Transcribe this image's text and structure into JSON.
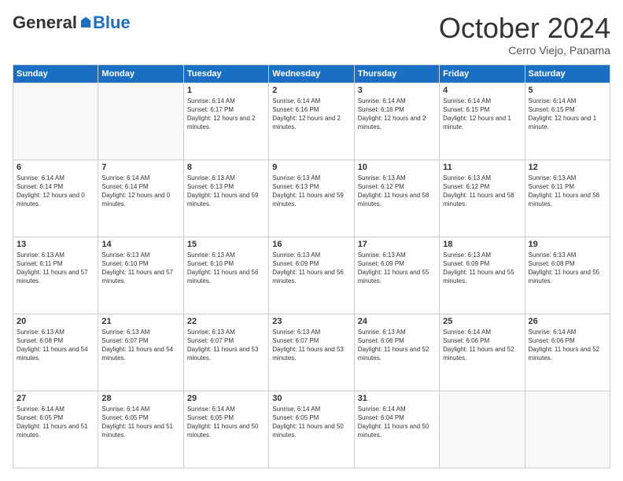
{
  "header": {
    "logo_general": "General",
    "logo_blue": "Blue",
    "month_title": "October 2024",
    "subtitle": "Cerro Viejo, Panama"
  },
  "days_of_week": [
    "Sunday",
    "Monday",
    "Tuesday",
    "Wednesday",
    "Thursday",
    "Friday",
    "Saturday"
  ],
  "weeks": [
    [
      {
        "day": "",
        "info": ""
      },
      {
        "day": "",
        "info": ""
      },
      {
        "day": "1",
        "info": "Sunrise: 6:14 AM\nSunset: 6:17 PM\nDaylight: 12 hours and 2 minutes."
      },
      {
        "day": "2",
        "info": "Sunrise: 6:14 AM\nSunset: 6:16 PM\nDaylight: 12 hours and 2 minutes."
      },
      {
        "day": "3",
        "info": "Sunrise: 6:14 AM\nSunset: 6:16 PM\nDaylight: 12 hours and 2 minutes."
      },
      {
        "day": "4",
        "info": "Sunrise: 6:14 AM\nSunset: 6:15 PM\nDaylight: 12 hours and 1 minute."
      },
      {
        "day": "5",
        "info": "Sunrise: 6:14 AM\nSunset: 6:15 PM\nDaylight: 12 hours and 1 minute."
      }
    ],
    [
      {
        "day": "6",
        "info": "Sunrise: 6:14 AM\nSunset: 6:14 PM\nDaylight: 12 hours and 0 minutes."
      },
      {
        "day": "7",
        "info": "Sunrise: 6:14 AM\nSunset: 6:14 PM\nDaylight: 12 hours and 0 minutes."
      },
      {
        "day": "8",
        "info": "Sunrise: 6:13 AM\nSunset: 6:13 PM\nDaylight: 11 hours and 59 minutes."
      },
      {
        "day": "9",
        "info": "Sunrise: 6:13 AM\nSunset: 6:13 PM\nDaylight: 11 hours and 59 minutes."
      },
      {
        "day": "10",
        "info": "Sunrise: 6:13 AM\nSunset: 6:12 PM\nDaylight: 11 hours and 58 minutes."
      },
      {
        "day": "11",
        "info": "Sunrise: 6:13 AM\nSunset: 6:12 PM\nDaylight: 11 hours and 58 minutes."
      },
      {
        "day": "12",
        "info": "Sunrise: 6:13 AM\nSunset: 6:11 PM\nDaylight: 11 hours and 58 minutes."
      }
    ],
    [
      {
        "day": "13",
        "info": "Sunrise: 6:13 AM\nSunset: 6:11 PM\nDaylight: 11 hours and 57 minutes."
      },
      {
        "day": "14",
        "info": "Sunrise: 6:13 AM\nSunset: 6:10 PM\nDaylight: 11 hours and 57 minutes."
      },
      {
        "day": "15",
        "info": "Sunrise: 6:13 AM\nSunset: 6:10 PM\nDaylight: 11 hours and 56 minutes."
      },
      {
        "day": "16",
        "info": "Sunrise: 6:13 AM\nSunset: 6:09 PM\nDaylight: 11 hours and 56 minutes."
      },
      {
        "day": "17",
        "info": "Sunrise: 6:13 AM\nSunset: 6:09 PM\nDaylight: 11 hours and 55 minutes."
      },
      {
        "day": "18",
        "info": "Sunrise: 6:13 AM\nSunset: 6:09 PM\nDaylight: 11 hours and 55 minutes."
      },
      {
        "day": "19",
        "info": "Sunrise: 6:13 AM\nSunset: 6:08 PM\nDaylight: 11 hours and 55 minutes."
      }
    ],
    [
      {
        "day": "20",
        "info": "Sunrise: 6:13 AM\nSunset: 6:08 PM\nDaylight: 11 hours and 54 minutes."
      },
      {
        "day": "21",
        "info": "Sunrise: 6:13 AM\nSunset: 6:07 PM\nDaylight: 11 hours and 54 minutes."
      },
      {
        "day": "22",
        "info": "Sunrise: 6:13 AM\nSunset: 6:07 PM\nDaylight: 11 hours and 53 minutes."
      },
      {
        "day": "23",
        "info": "Sunrise: 6:13 AM\nSunset: 6:07 PM\nDaylight: 11 hours and 53 minutes."
      },
      {
        "day": "24",
        "info": "Sunrise: 6:13 AM\nSunset: 6:06 PM\nDaylight: 11 hours and 52 minutes."
      },
      {
        "day": "25",
        "info": "Sunrise: 6:14 AM\nSunset: 6:06 PM\nDaylight: 11 hours and 52 minutes."
      },
      {
        "day": "26",
        "info": "Sunrise: 6:14 AM\nSunset: 6:06 PM\nDaylight: 11 hours and 52 minutes."
      }
    ],
    [
      {
        "day": "27",
        "info": "Sunrise: 6:14 AM\nSunset: 6:05 PM\nDaylight: 11 hours and 51 minutes."
      },
      {
        "day": "28",
        "info": "Sunrise: 6:14 AM\nSunset: 6:05 PM\nDaylight: 11 hours and 51 minutes."
      },
      {
        "day": "29",
        "info": "Sunrise: 6:14 AM\nSunset: 6:05 PM\nDaylight: 11 hours and 50 minutes."
      },
      {
        "day": "30",
        "info": "Sunrise: 6:14 AM\nSunset: 6:05 PM\nDaylight: 11 hours and 50 minutes."
      },
      {
        "day": "31",
        "info": "Sunrise: 6:14 AM\nSunset: 6:04 PM\nDaylight: 11 hours and 50 minutes."
      },
      {
        "day": "",
        "info": ""
      },
      {
        "day": "",
        "info": ""
      }
    ]
  ]
}
